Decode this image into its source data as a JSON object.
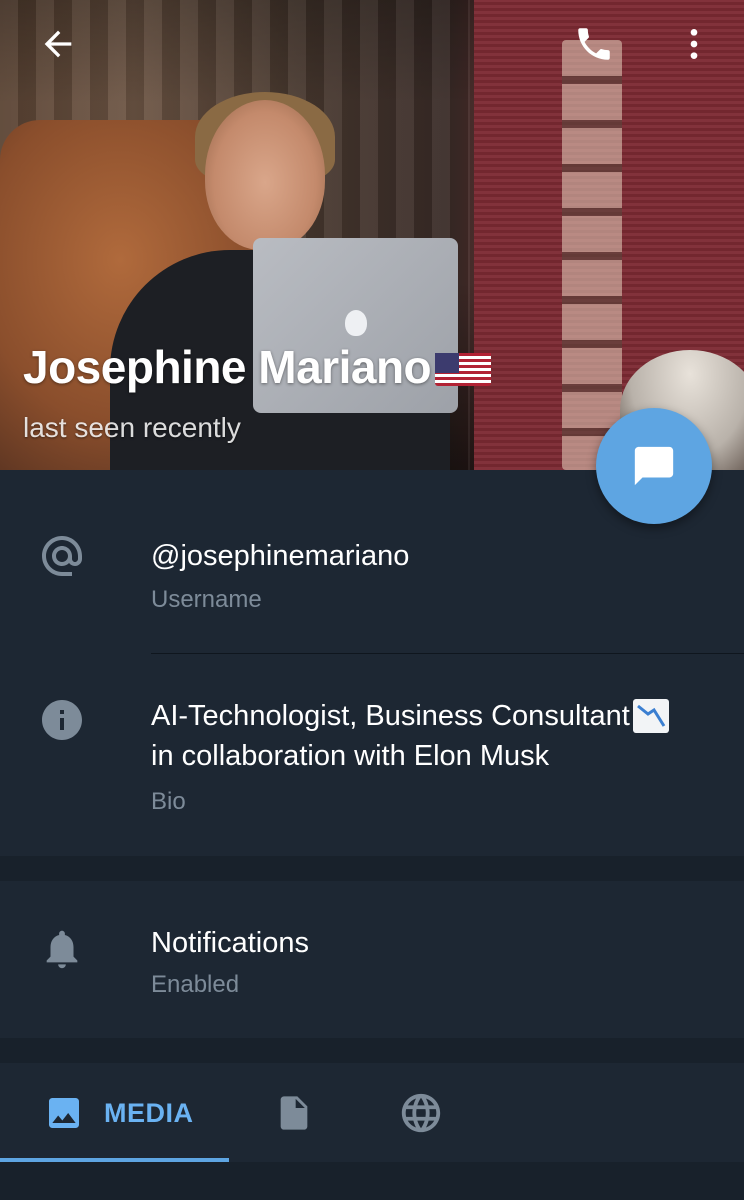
{
  "header": {
    "name": "Josephine Mariano",
    "flag_icon": "us-flag-icon",
    "status": "last seen recently",
    "actions": {
      "back_icon": "arrow-left-icon",
      "call_icon": "phone-icon",
      "more_icon": "more-vertical-icon"
    },
    "fab_icon": "message-icon"
  },
  "info": {
    "username": {
      "value": "@josephinemariano",
      "label": "Username",
      "icon": "at-icon"
    },
    "bio": {
      "line1": "AI-Technologist, Business Consultant",
      "line2": "in collaboration with Elon Musk",
      "emoji_icon": "chart-decreasing-icon",
      "label": "Bio",
      "icon": "info-icon"
    }
  },
  "notifications": {
    "value": "Notifications",
    "label": "Enabled",
    "icon": "bell-icon"
  },
  "tabs": {
    "media": {
      "label": "MEDIA",
      "icon": "image-icon",
      "active": true
    },
    "files": {
      "icon": "file-icon"
    },
    "links": {
      "icon": "globe-icon"
    }
  },
  "colors": {
    "accent": "#5ea5e2",
    "background": "#18212b",
    "surface": "#1d2733",
    "secondary_text": "#7d8b99"
  }
}
